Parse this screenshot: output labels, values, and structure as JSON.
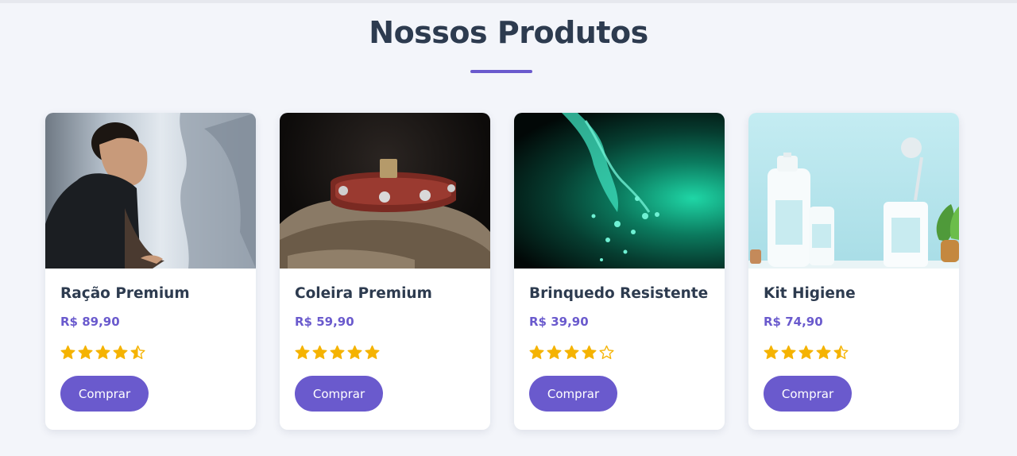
{
  "section": {
    "title": "Nossos Produtos"
  },
  "colors": {
    "accent": "#6a5acd",
    "title": "#2d3b4f",
    "star": "#f5b301",
    "background": "#f3f5fa"
  },
  "products": [
    {
      "name": "Ração Premium",
      "price": "R$ 89,90",
      "rating": 4.5,
      "button_label": "Comprar",
      "image_icon": "man-mountain-photo"
    },
    {
      "name": "Coleira Premium",
      "price": "R$ 59,90",
      "rating": 5,
      "button_label": "Comprar",
      "image_icon": "leather-collar-photo"
    },
    {
      "name": "Brinquedo Resistente",
      "price": "R$ 39,90",
      "rating": 4,
      "button_label": "Comprar",
      "image_icon": "water-splash-photo"
    },
    {
      "name": "Kit Higiene",
      "price": "R$ 74,90",
      "rating": 4.5,
      "button_label": "Comprar",
      "image_icon": "hygiene-products-photo"
    }
  ]
}
